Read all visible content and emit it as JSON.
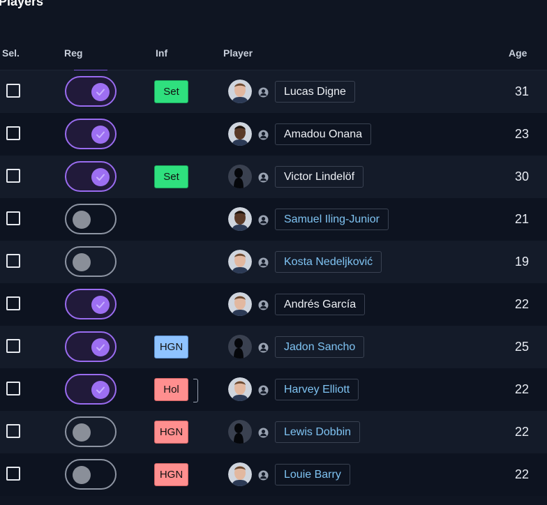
{
  "page_title": "Players",
  "columns": {
    "sel": "Sel.",
    "reg": "Reg",
    "inf": "Inf",
    "player": "Player",
    "age": "Age"
  },
  "rows": [
    {
      "registered": true,
      "inf": "Set",
      "inf_color": "green",
      "bracket": false,
      "avatar": "photo-light",
      "name": "Lucas Digne",
      "name_style": "white",
      "age": "31"
    },
    {
      "registered": true,
      "inf": "",
      "inf_color": "",
      "bracket": false,
      "avatar": "photo-dark",
      "name": "Amadou Onana",
      "name_style": "white",
      "age": "23"
    },
    {
      "registered": true,
      "inf": "Set",
      "inf_color": "green",
      "bracket": false,
      "avatar": "silhouette",
      "name": "Victor Lindelöf",
      "name_style": "white",
      "age": "30"
    },
    {
      "registered": false,
      "inf": "",
      "inf_color": "",
      "bracket": false,
      "avatar": "photo-dark",
      "name": "Samuel Iling-Junior",
      "name_style": "blue",
      "age": "21"
    },
    {
      "registered": false,
      "inf": "",
      "inf_color": "",
      "bracket": false,
      "avatar": "photo-light",
      "name": "Kosta Nedeljković",
      "name_style": "blue",
      "age": "19"
    },
    {
      "registered": true,
      "inf": "",
      "inf_color": "",
      "bracket": false,
      "avatar": "photo-light",
      "name": "Andrés García",
      "name_style": "white",
      "age": "22"
    },
    {
      "registered": true,
      "inf": "HGN",
      "inf_color": "blue",
      "bracket": false,
      "avatar": "silhouette",
      "name": "Jadon Sancho",
      "name_style": "blue",
      "age": "25"
    },
    {
      "registered": true,
      "inf": "Hol",
      "inf_color": "red",
      "bracket": true,
      "avatar": "photo-light",
      "name": "Harvey Elliott",
      "name_style": "blue",
      "age": "22"
    },
    {
      "registered": false,
      "inf": "HGN",
      "inf_color": "red",
      "bracket": false,
      "avatar": "silhouette",
      "name": "Lewis Dobbin",
      "name_style": "blue",
      "age": "22"
    },
    {
      "registered": false,
      "inf": "HGN",
      "inf_color": "red",
      "bracket": false,
      "avatar": "photo-light",
      "name": "Louie Barry",
      "name_style": "blue",
      "age": "22"
    }
  ],
  "icons": {
    "checkbox": "checkbox-icon",
    "toggle_check": "check-icon",
    "person": "person-icon"
  },
  "colors": {
    "accent_purple": "#9d6ff2",
    "name_link_blue": "#7fc3f2",
    "badge_green": "#2fe07e",
    "badge_blue": "#8fc3ff",
    "badge_red": "#ff8f8f"
  }
}
